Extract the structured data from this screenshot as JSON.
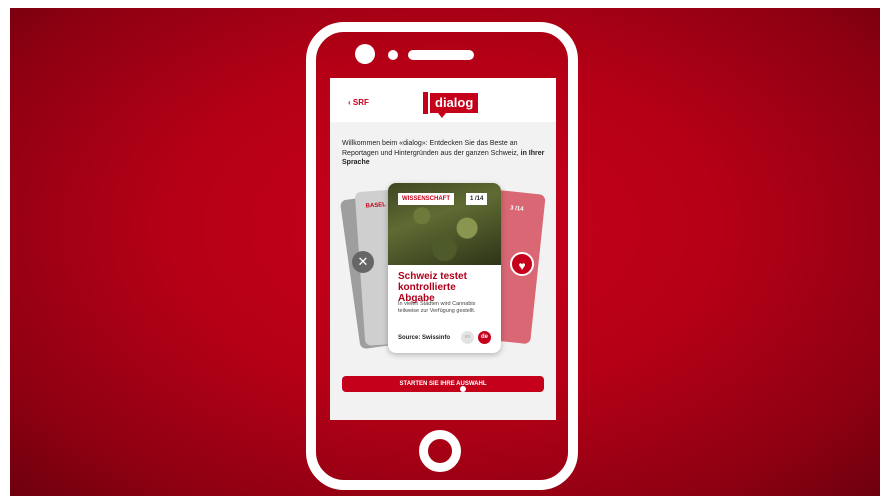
{
  "header": {
    "back_label": "‹ SRF",
    "logo_text": "dialog"
  },
  "intro": {
    "text": "Willkommen beim «dialog»: Entdecken Sie das Beste an Reportagen und Hintergründen aus der ganzen Schweiz, ",
    "bold": "in Ihrer Sprache"
  },
  "cards": {
    "left_badge": "BASEL",
    "right_badge": "3 /14",
    "main": {
      "tag": "WISSENSCHAFT",
      "counter": "1 /14",
      "title": "Schweiz testet kontrollierte Abgabe",
      "text": "In vielen Städten wird Cannabis teilweise zur Verfügung gestellt.",
      "source": "Source: Swissinfo",
      "lang_inactive": "en",
      "lang_active": "de"
    }
  },
  "actions": {
    "dismiss_icon": "close-icon",
    "like_icon": "heart-icon",
    "start_label": "STARTEN SIE IHRE AUSWAHL"
  },
  "colors": {
    "brand": "#c4001a",
    "background": "#b50016"
  }
}
